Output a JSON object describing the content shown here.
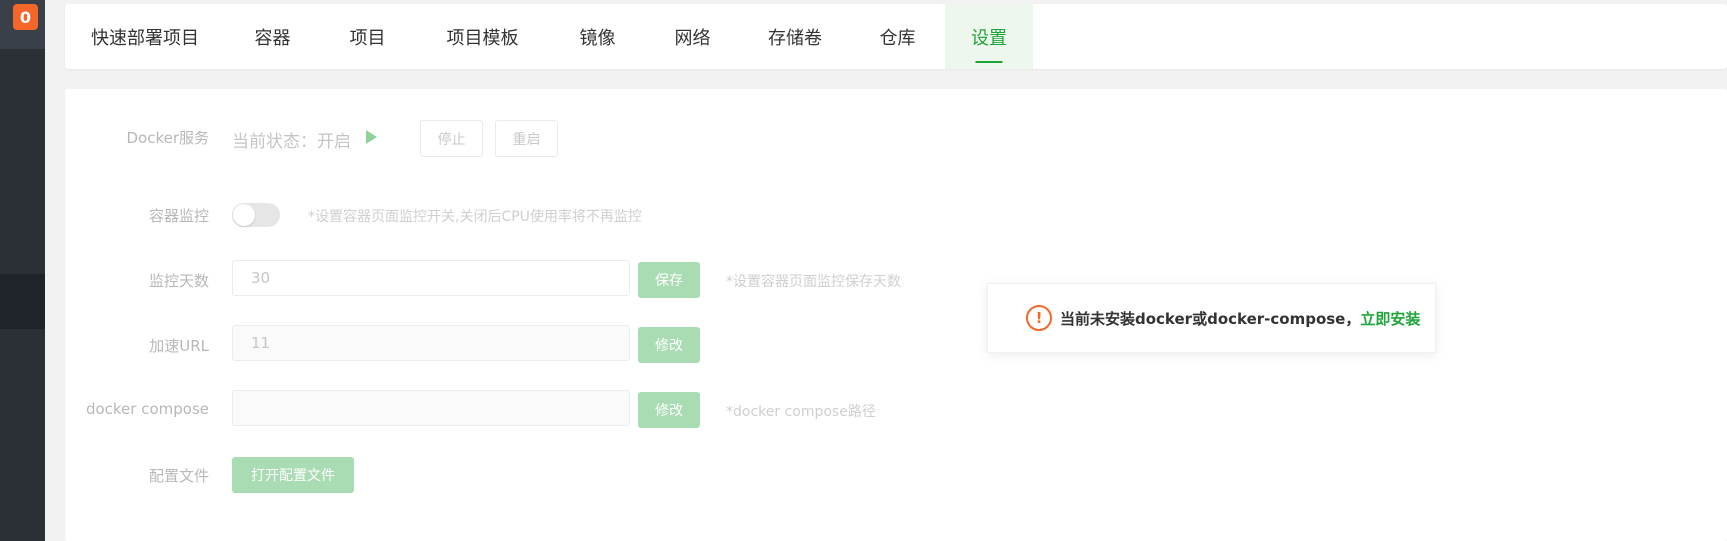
{
  "sidebar": {
    "badge": "0"
  },
  "tabs": [
    {
      "label": "快速部署项目"
    },
    {
      "label": "容器"
    },
    {
      "label": "项目"
    },
    {
      "label": "项目模板"
    },
    {
      "label": "镜像"
    },
    {
      "label": "网络"
    },
    {
      "label": "存储卷"
    },
    {
      "label": "仓库"
    },
    {
      "label": "设置",
      "active": true
    }
  ],
  "settings": {
    "docker_service": {
      "label": "Docker服务",
      "status": "当前状态：开启",
      "stop_button": "停止",
      "restart_button": "重启"
    },
    "monitor": {
      "label": "容器监控",
      "enabled": false,
      "hint": "*设置容器页面监控开关,关闭后CPU使用率将不再监控"
    },
    "monitor_days": {
      "label": "监控天数",
      "value": "30",
      "save_button": "保存",
      "hint": "*设置容器页面监控保存天数"
    },
    "mirror_url": {
      "label": "加速URL",
      "value": "11",
      "edit_button": "修改"
    },
    "docker_compose": {
      "label": "docker compose",
      "value": "",
      "edit_button": "修改",
      "hint": "*docker compose路径"
    },
    "config_file": {
      "label": "配置文件",
      "open_button": "打开配置文件"
    }
  },
  "toast": {
    "message": "当前未安装docker或docker-compose，",
    "link": "立即安装"
  },
  "colors": {
    "accent": "#20a53a",
    "warning": "#f5662a",
    "sidebar": "#2b3037"
  }
}
